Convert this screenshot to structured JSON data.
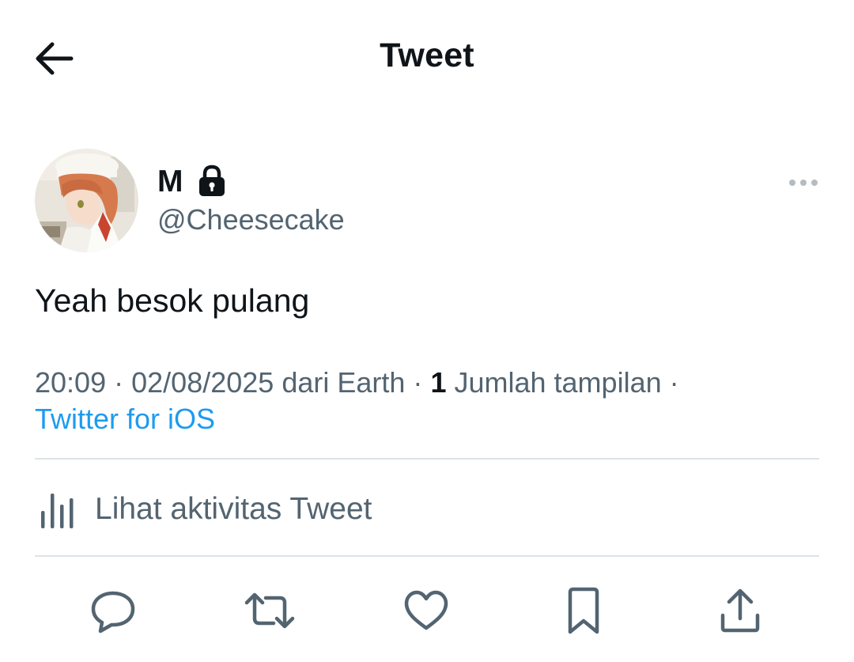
{
  "header": {
    "title": "Tweet",
    "back_icon": "arrow-left-icon"
  },
  "author": {
    "display_name": "M",
    "handle": "@Cheesecake",
    "protected_icon": "lock-icon",
    "avatar_description": "anime-avatar"
  },
  "tweet": {
    "text": "Yeah besok pulang",
    "time": "20:09",
    "date": "02/08/2025",
    "location_text": "dari Earth",
    "views_count": "1",
    "views_label": "Jumlah tampilan",
    "separator": "·",
    "client": "Twitter for iOS"
  },
  "activity": {
    "label": "Lihat aktivitas Tweet",
    "icon": "bar-chart-icon"
  },
  "actions": {
    "reply_icon": "reply-icon",
    "retweet_icon": "retweet-icon",
    "like_icon": "heart-icon",
    "bookmark_icon": "bookmark-icon",
    "share_icon": "share-icon"
  },
  "colors": {
    "text_primary": "#0f1419",
    "text_secondary": "#536471",
    "accent": "#1d9bf0",
    "divider": "#dde3e7"
  }
}
